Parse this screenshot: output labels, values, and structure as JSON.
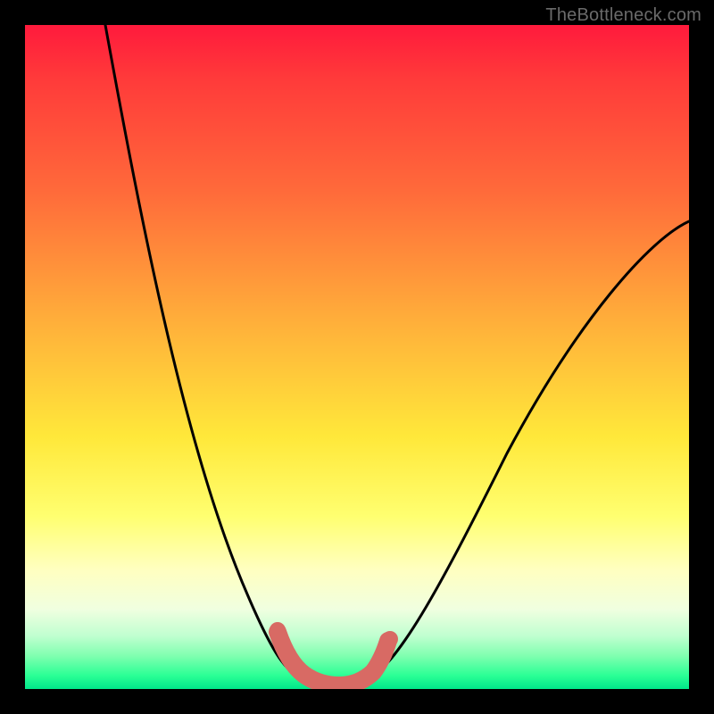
{
  "watermark": {
    "text": "TheBottleneck.com"
  },
  "chart_data": {
    "type": "line",
    "title": "",
    "xlabel": "",
    "ylabel": "",
    "xlim": [
      0,
      100
    ],
    "ylim": [
      0,
      100
    ],
    "grid": false,
    "series": [
      {
        "name": "bottleneck-curve",
        "color": "#000000",
        "x": [
          12,
          14,
          16,
          18,
          20,
          22,
          24,
          26,
          28,
          30,
          32,
          34,
          36,
          38,
          40,
          42,
          44,
          46,
          48,
          50,
          55,
          60,
          65,
          70,
          75,
          80,
          85,
          90,
          95,
          100
        ],
        "values": [
          100,
          92,
          84,
          76,
          68,
          60,
          53,
          46,
          39,
          33,
          27,
          21,
          16,
          11,
          7,
          4,
          2,
          1,
          1,
          2,
          8,
          15,
          22,
          30,
          38,
          46,
          54,
          62,
          70,
          65
        ]
      },
      {
        "name": "optimum-marker",
        "color": "#d86a64",
        "x": [
          38,
          39,
          40,
          41,
          42,
          43,
          44,
          45,
          46,
          47,
          48,
          49,
          50
        ],
        "values": [
          8,
          6,
          4.5,
          3.5,
          3,
          2.7,
          2.6,
          2.7,
          3,
          3.5,
          4.5,
          6,
          8
        ]
      }
    ],
    "annotations": []
  }
}
